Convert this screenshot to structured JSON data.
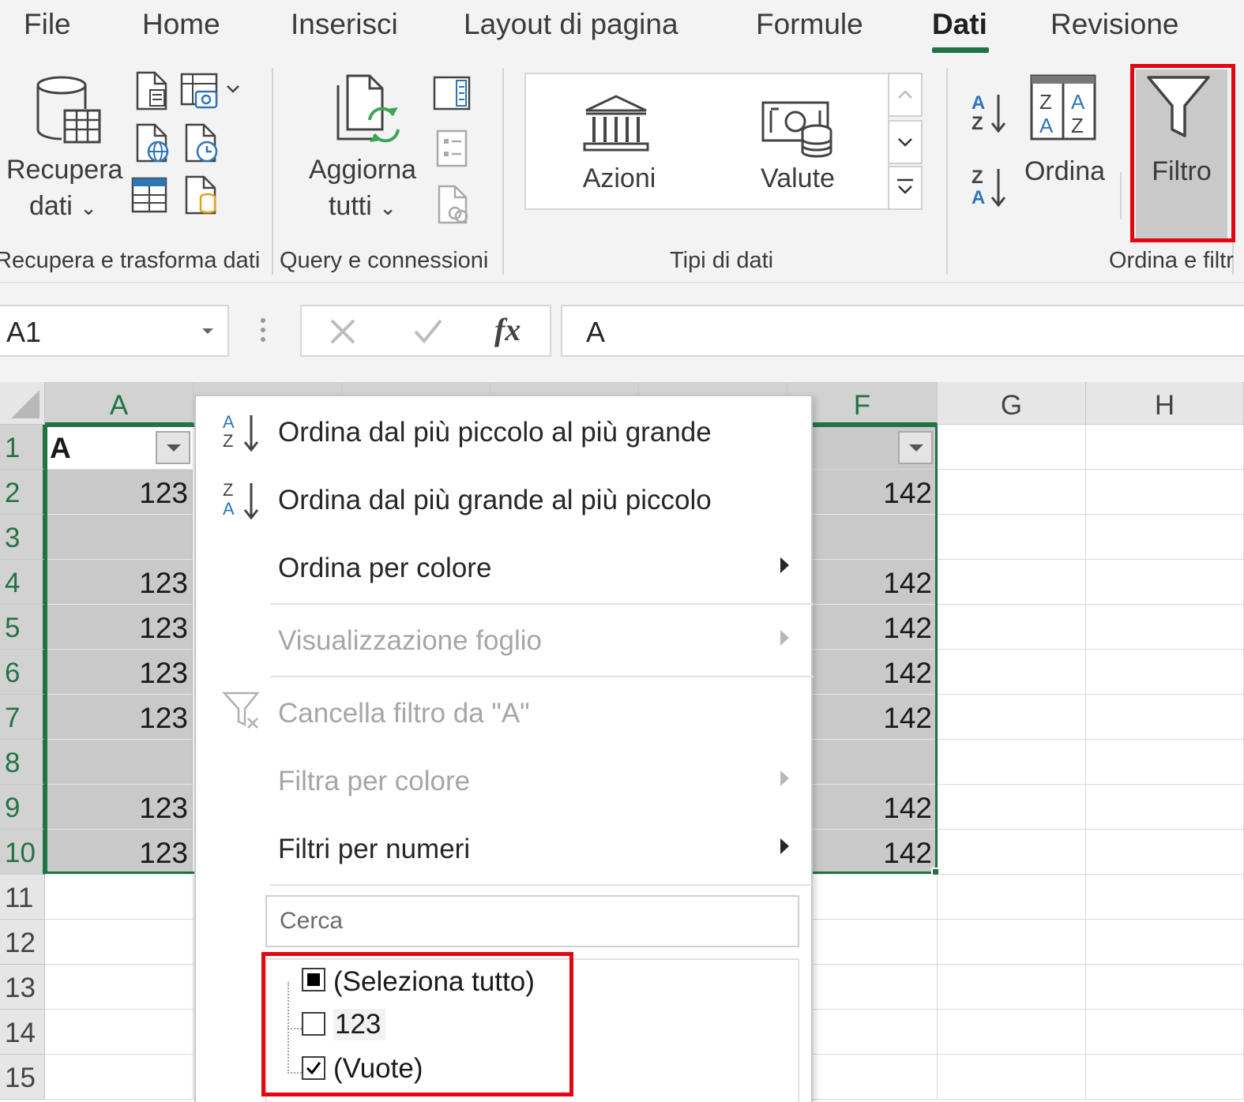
{
  "tabs": [
    "File",
    "Home",
    "Inserisci",
    "Layout di pagina",
    "Formule",
    "Dati",
    "Revisione"
  ],
  "active_tab": "Dati",
  "ribbon": {
    "get_data": {
      "line1": "Recupera",
      "line2": "dati",
      "chevron": "⌄"
    },
    "refresh": {
      "line1": "Aggiorna",
      "line2": "tutti",
      "chevron": "⌄"
    },
    "datatypes": {
      "stocks": "Azioni",
      "currencies": "Valute"
    },
    "sort_label": "Ordina",
    "filter_label": "Filtro",
    "groups": {
      "get_transform": "Recupera e trasforma dati",
      "queries": "Query e connessioni",
      "datatypes": "Tipi di dati",
      "sort_filter": "Ordina e filtr"
    }
  },
  "formula_bar": {
    "name_box": "A1",
    "fx": "fx",
    "value": "A"
  },
  "grid": {
    "columns": [
      "A",
      "F",
      "G",
      "H"
    ],
    "rows": [
      "1",
      "2",
      "3",
      "4",
      "5",
      "6",
      "7",
      "8",
      "9",
      "10",
      "11",
      "12",
      "13",
      "14",
      "15"
    ],
    "header_a1": "A",
    "col_a_values": [
      "123",
      "",
      "123",
      "123",
      "123",
      "123",
      "",
      "123",
      "123"
    ],
    "col_f_values": [
      "142",
      "",
      "142",
      "142",
      "142",
      "142",
      "",
      "142",
      "142"
    ]
  },
  "filter_menu": {
    "sort_asc": "Ordina dal più piccolo al più grande",
    "sort_desc": "Ordina dal più grande al più piccolo",
    "sort_by_color": "Ordina per colore",
    "sheet_view": "Visualizzazione foglio",
    "clear_filter": "Cancella filtro da \"A\"",
    "filter_by_color": "Filtra per colore",
    "number_filters": "Filtri per numeri",
    "search_placeholder": "Cerca",
    "items": [
      {
        "label": "(Seleziona tutto)",
        "state": "partial"
      },
      {
        "label": "123",
        "state": "unchecked"
      },
      {
        "label": "(Vuote)",
        "state": "checked"
      }
    ]
  },
  "colors": {
    "accent": "#217346",
    "highlight": "#e30613",
    "selection": "#c9c9c9"
  }
}
